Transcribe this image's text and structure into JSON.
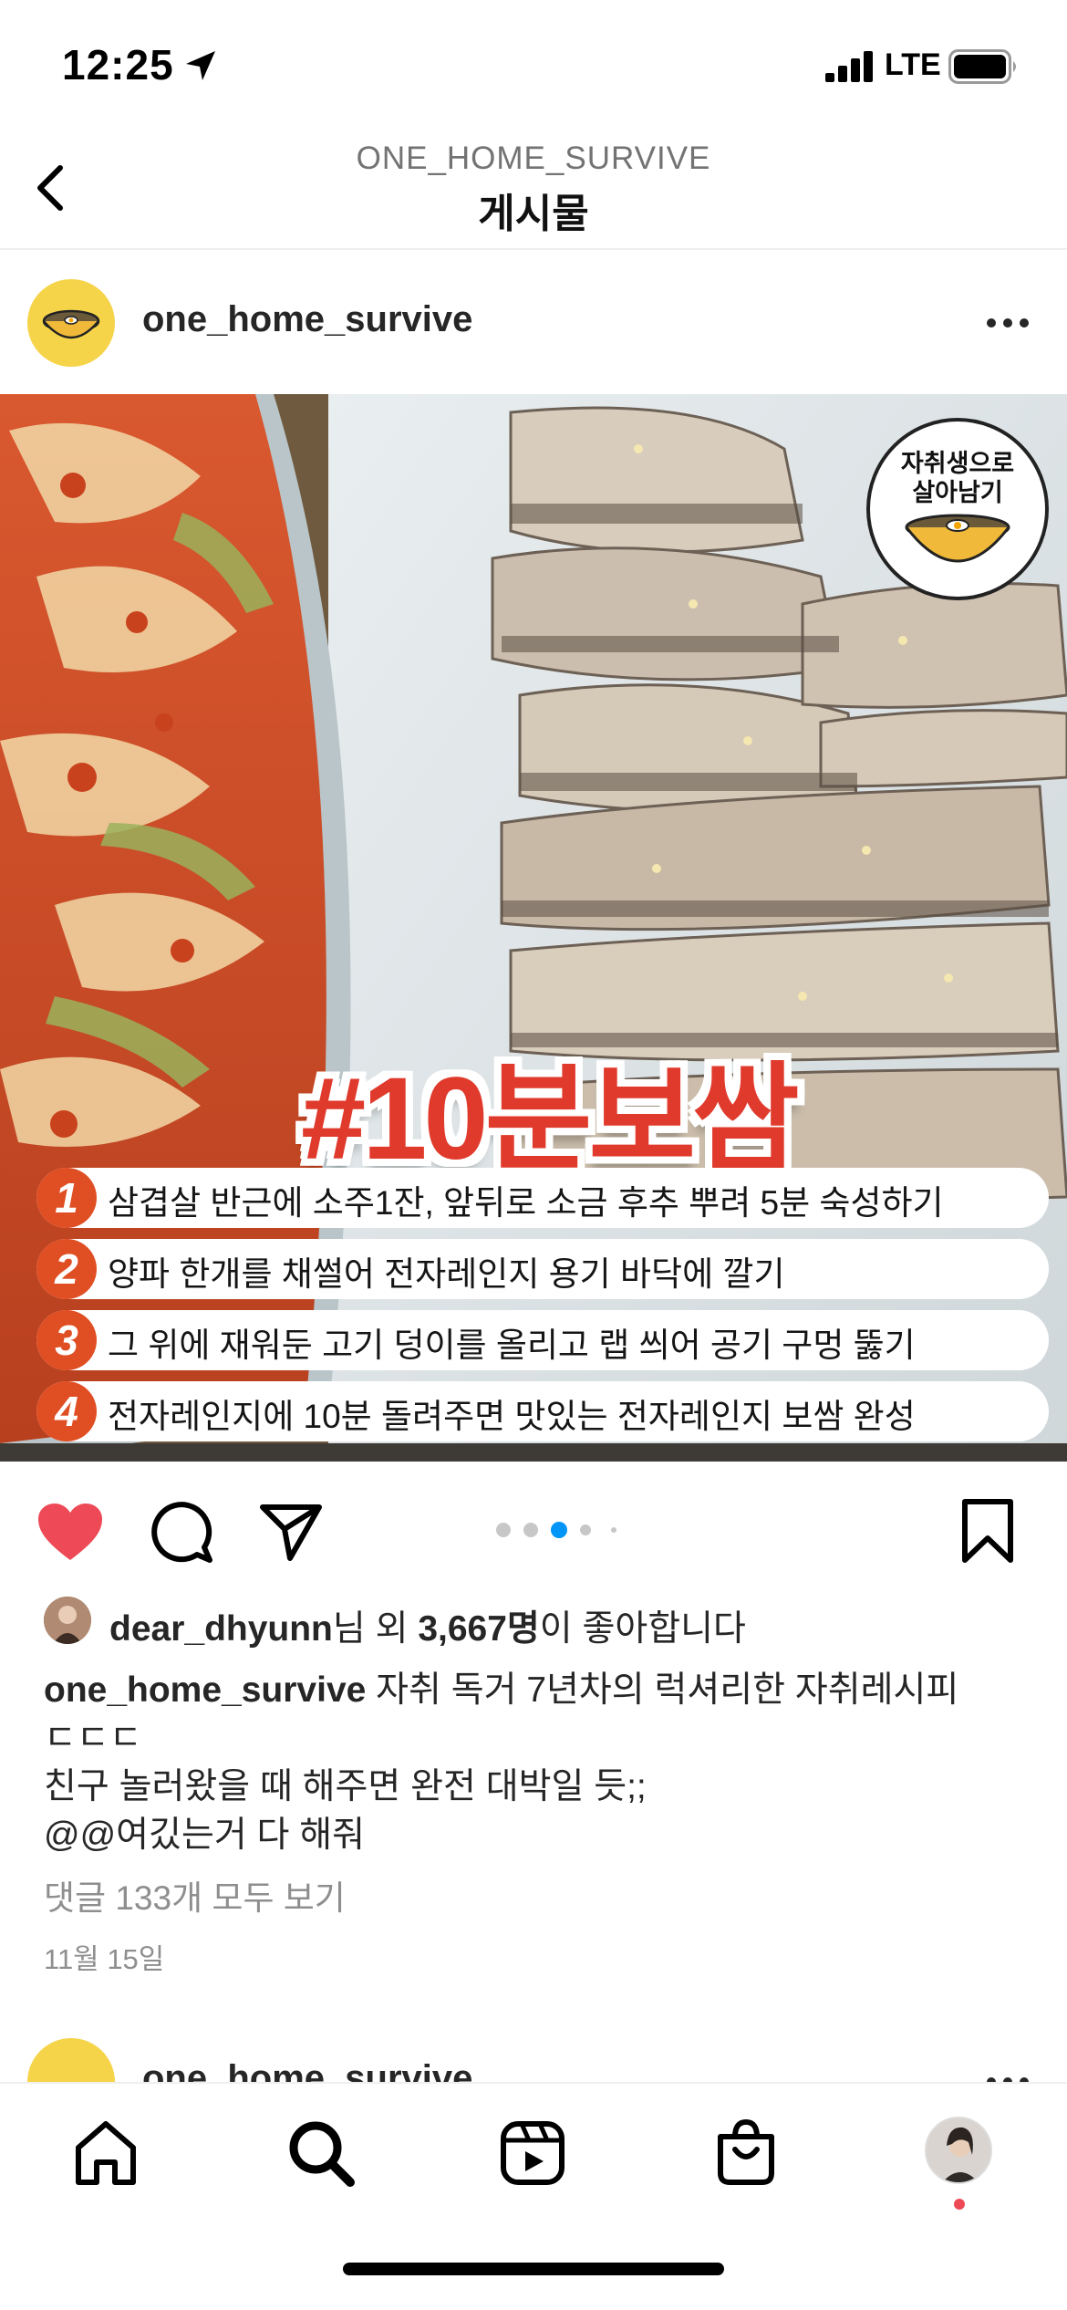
{
  "status_bar": {
    "time": "12:25",
    "network": "LTE"
  },
  "nav": {
    "account": "ONE_HOME_SURVIVE",
    "title": "게시물"
  },
  "post": {
    "username": "one_home_survive",
    "image": {
      "logo_text_line1": "자취생으로",
      "logo_text_line2": "살아남기",
      "hashtag": "#10분보쌈",
      "steps": [
        {
          "num": "1",
          "text": "삼겹살 반근에 소주1잔, 앞뒤로 소금 후추 뿌려 5분 숙성하기"
        },
        {
          "num": "2",
          "text": "양파 한개를 채썰어 전자레인지 용기 바닥에 깔기"
        },
        {
          "num": "3",
          "text": "그 위에 재워둔 고기 덩이를 올리고 랩 씌어 공기 구멍 뚫기"
        },
        {
          "num": "4",
          "text": "전자레인지에 10분 돌려주면 맛있는 전자레인지 보쌈 완성"
        }
      ]
    },
    "carousel": {
      "total": 5,
      "active": 3
    },
    "liked": true,
    "likes": {
      "user": "dear_dhyunn",
      "mid": "님 외 ",
      "count": "3,667명",
      "suffix": "이 좋아합니다"
    },
    "caption": {
      "username": "one_home_survive",
      "line1": " 자취 독거 7년차의 럭셔리한 자취레시피",
      "line2": "ㄷㄷㄷ",
      "line3": "친구 놀러왔을 때 해주면 완전 대박일 듯;;",
      "line4": "@@여깄는거 다 해줘"
    },
    "view_comments": "댓글 133개 모두 보기",
    "date": "11월 15일"
  },
  "next_post": {
    "username": "one_home_survive"
  },
  "tab_bar": {
    "items": [
      "home-icon",
      "search-icon",
      "reels-icon",
      "shop-icon",
      "profile-avatar"
    ],
    "has_notification": true
  },
  "colors": {
    "like_red": "#ed4956",
    "active_dot": "#0095f6",
    "accent_orange": "#e04e23"
  }
}
